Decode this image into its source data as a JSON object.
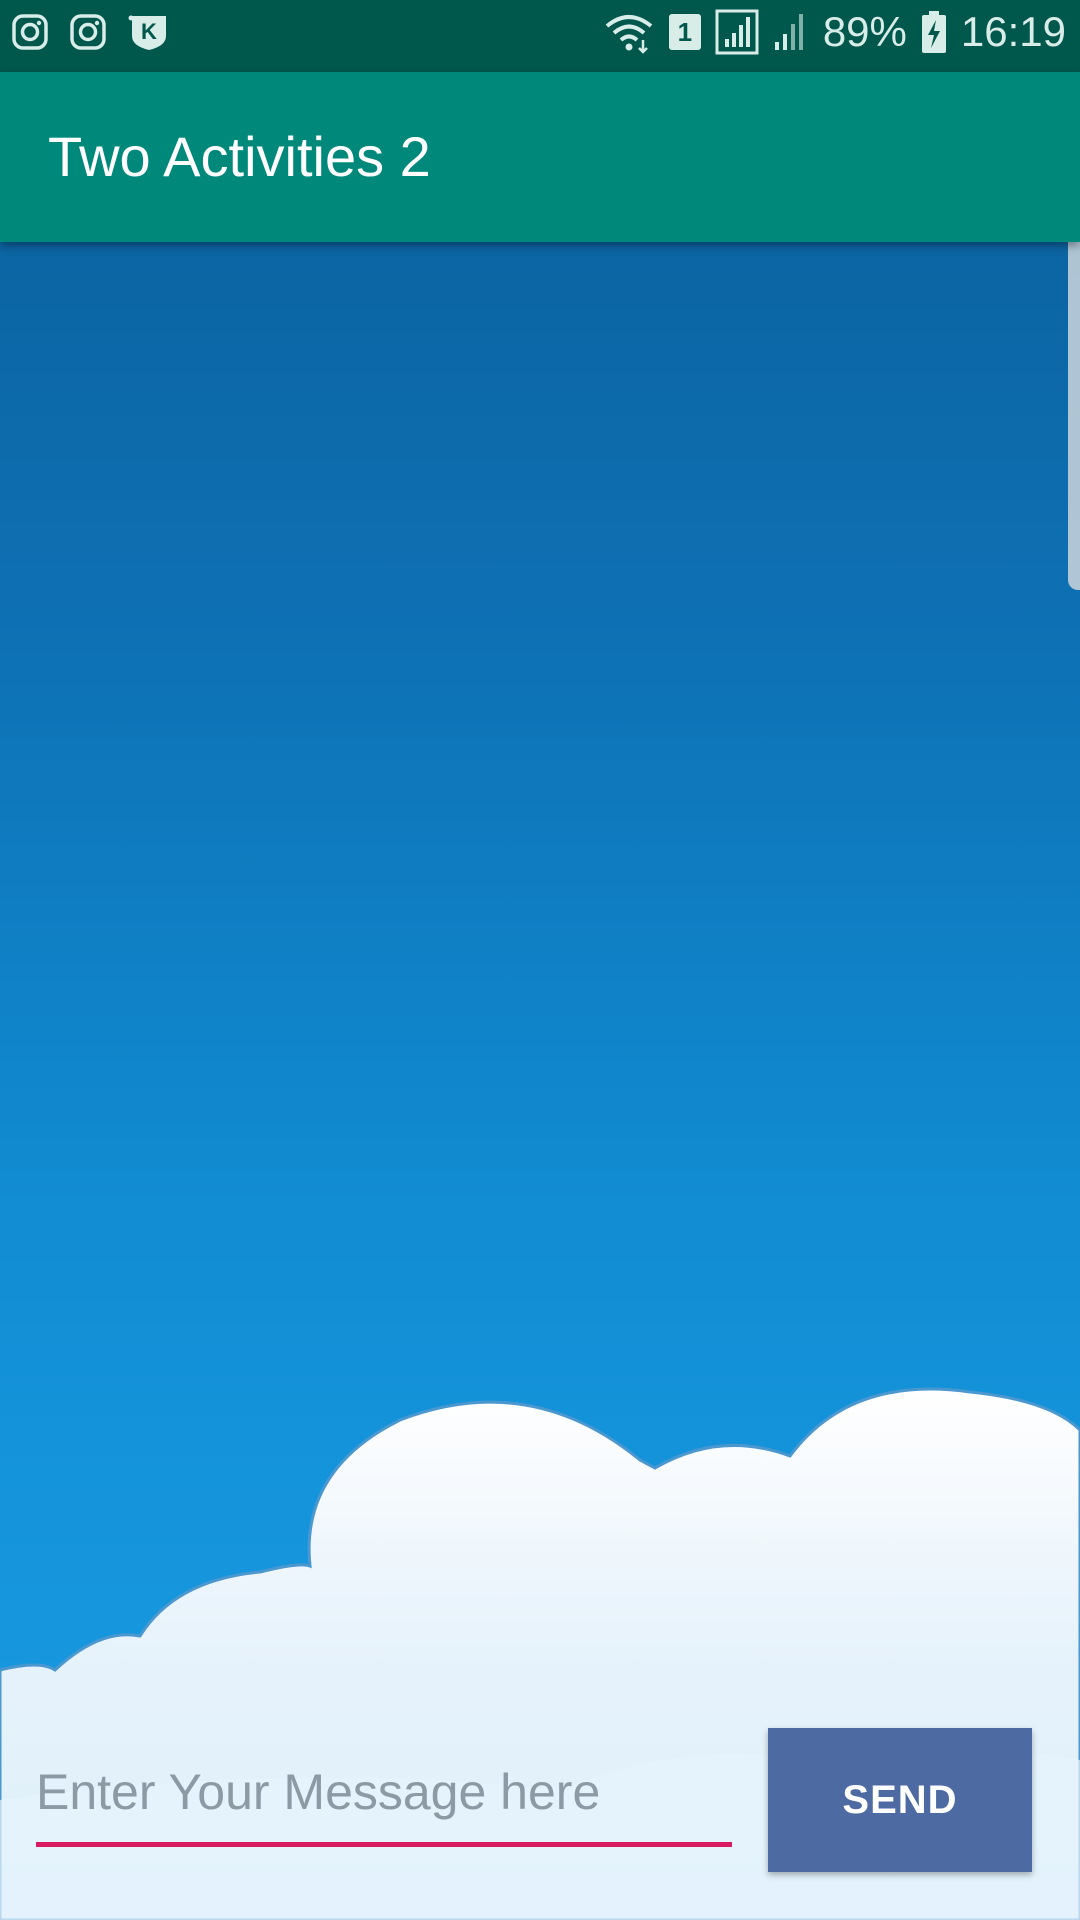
{
  "status_bar": {
    "left_icons": [
      "instagram-icon",
      "instagram-icon",
      "kik-icon"
    ],
    "sim_slot": "1",
    "battery_percent": "89%",
    "time": "16:19"
  },
  "app_bar": {
    "title": "Two Activities 2",
    "color": "#00897b"
  },
  "message_form": {
    "placeholder": "Enter Your Message here",
    "value": "",
    "send_label": "SEND",
    "underline_color": "#d81b60",
    "button_color": "#4e6aa3"
  }
}
